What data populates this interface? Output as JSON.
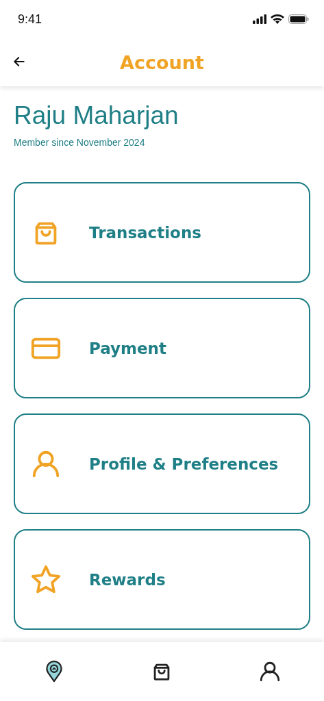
{
  "status_bar": {
    "time": "9:41"
  },
  "header": {
    "title": "Account"
  },
  "profile": {
    "name": "Raju Maharjan",
    "member_since": "Member since November 2024"
  },
  "menu": [
    {
      "kind": "bag",
      "label": "Transactions"
    },
    {
      "kind": "card",
      "label": "Payment"
    },
    {
      "kind": "user",
      "label": "Profile & Preferences"
    },
    {
      "kind": "star",
      "label": "Rewards"
    }
  ],
  "bottom_nav": [
    {
      "kind": "pin",
      "selected": true
    },
    {
      "kind": "bag",
      "selected": false
    },
    {
      "kind": "user",
      "selected": false
    }
  ]
}
